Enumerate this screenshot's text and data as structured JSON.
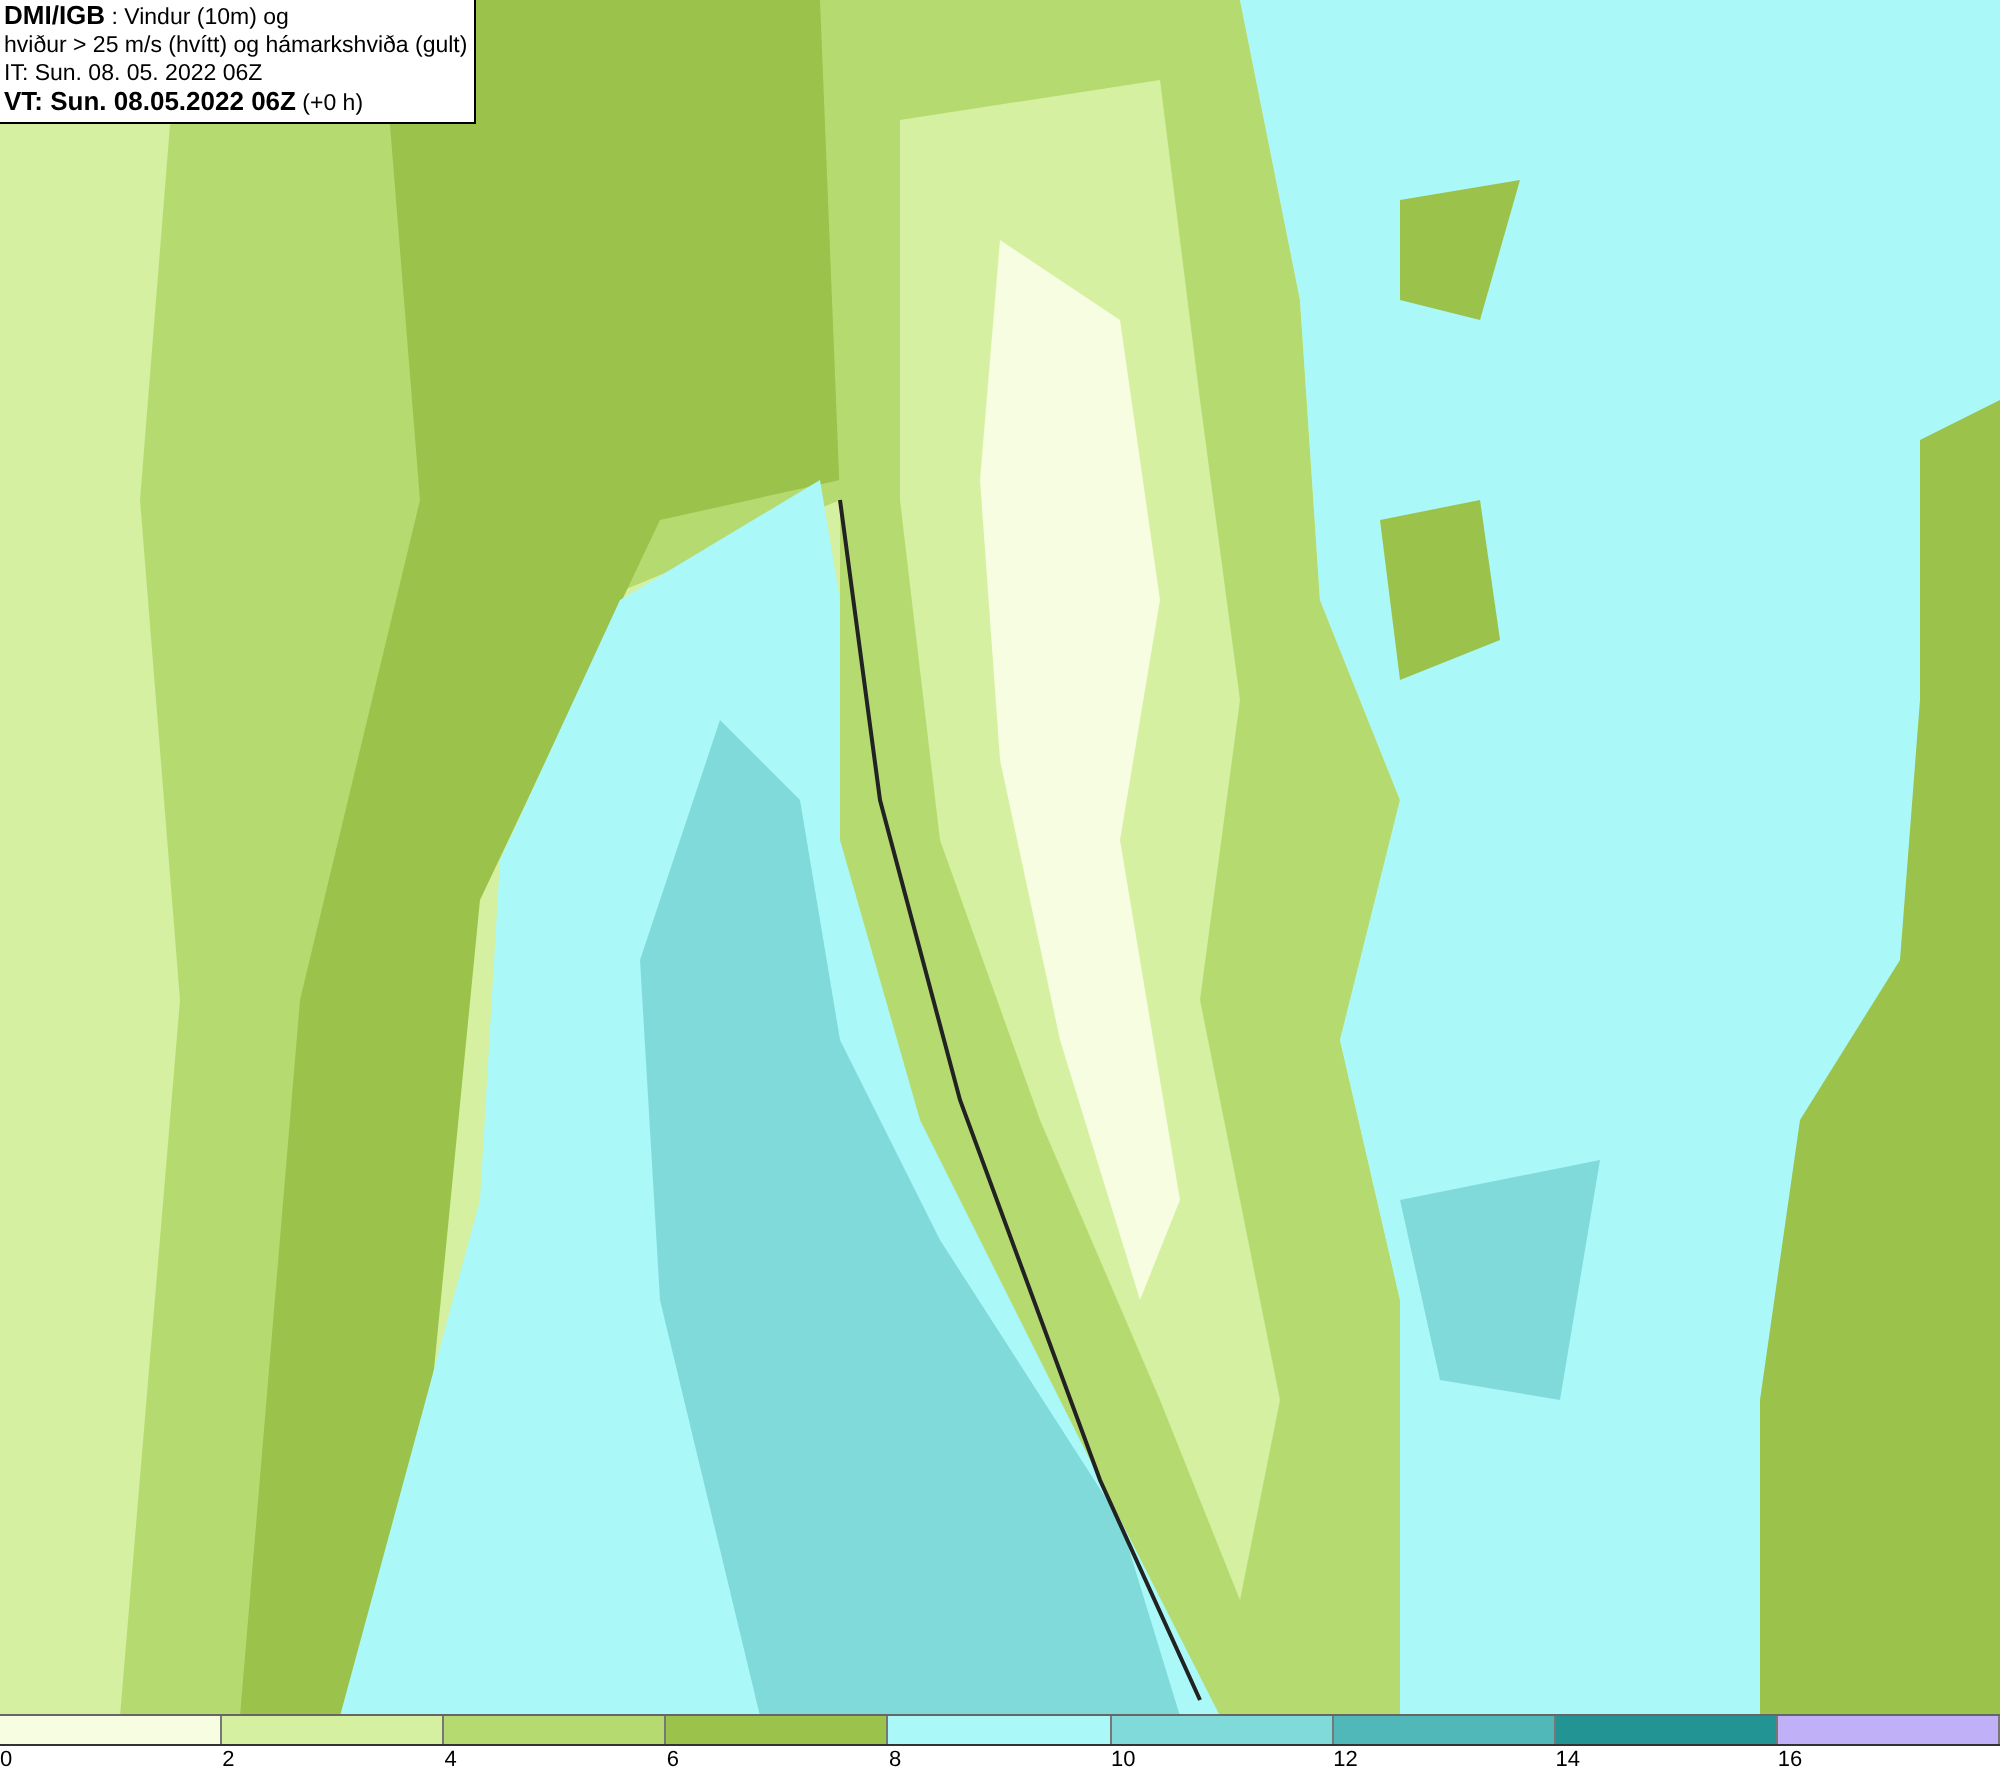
{
  "header": {
    "lines": [
      "**DMI/IGB** : Vindur (10m) og",
      "hviður > 25 m/s (hvítt) og hámarkshviða (gult)",
      "IT: Sun. 08. 05. 2022 06Z",
      "**VT: Sun. 08.05.2022 06Z** (+0 h)"
    ]
  },
  "legend": {
    "bins": [
      {
        "color": "#f7fde0",
        "label": "0"
      },
      {
        "color": "#d5f0a0",
        "label": "2"
      },
      {
        "color": "#b5db70",
        "label": "4"
      },
      {
        "color": "#9bc24a",
        "label": "6"
      },
      {
        "color": "#aaf8f8",
        "label": "8"
      },
      {
        "color": "#80dada",
        "label": "10"
      },
      {
        "color": "#50b8b8",
        "label": "12"
      },
      {
        "color": "#239494",
        "label": "14"
      },
      {
        "color": "#c0b0f8",
        "label": "16"
      }
    ]
  }
}
